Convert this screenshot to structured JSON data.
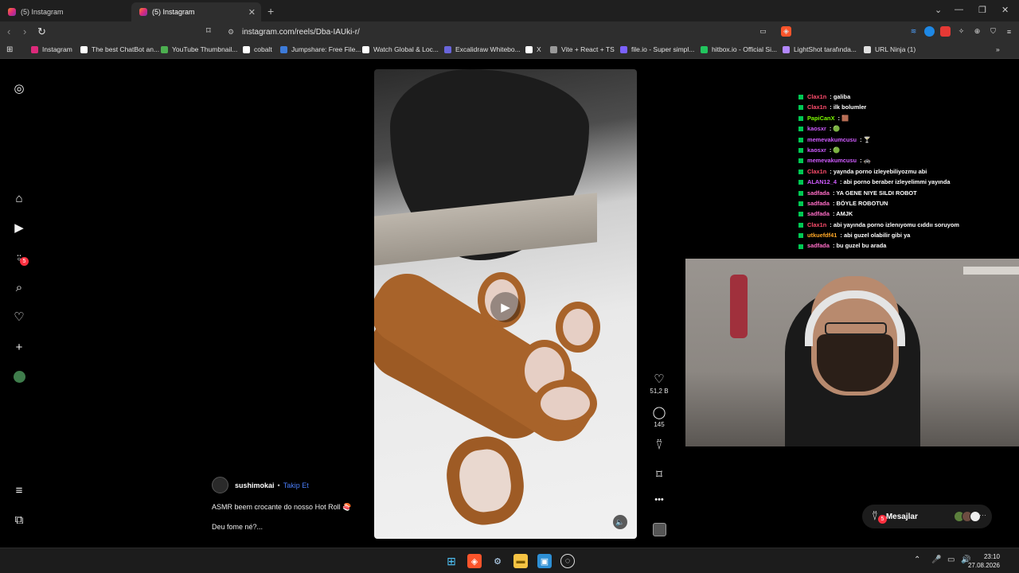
{
  "browser": {
    "tabs": [
      {
        "label": "(5) Instagram"
      },
      {
        "label": "(5) Instagram"
      }
    ],
    "url": "instagram.com/reels/Dba-IAUki-r/",
    "bookmarks": [
      {
        "label": "Instagram",
        "color": "#dd2a7b"
      },
      {
        "label": "The best ChatBot an...",
        "color": "#ffffff"
      },
      {
        "label": "YouTube Thumbnail...",
        "color": "#4caf50"
      },
      {
        "label": "cobalt",
        "color": "#ffffff"
      },
      {
        "label": "Jumpshare: Free File...",
        "color": "#3d7bd9"
      },
      {
        "label": "Watch Global & Loc...",
        "color": "#ffffff"
      },
      {
        "label": "Excalidraw Whitebo...",
        "color": "#6965db"
      },
      {
        "label": "X",
        "color": "#ffffff"
      },
      {
        "label": "Vite + React + TS",
        "color": "#9a9a9a"
      },
      {
        "label": "file.io - Super simpl...",
        "color": "#7b61ff"
      },
      {
        "label": "hitbox.io - Official Si...",
        "color": "#22c55e"
      },
      {
        "label": "LightShot tarafında...",
        "color": "#b388ff"
      },
      {
        "label": "URL Ninja (1)",
        "color": "#e0e0e0"
      }
    ]
  },
  "sidebar": {
    "notification_count": "5"
  },
  "reel": {
    "username": "sushimokai",
    "follow_label": "Takip Et",
    "caption_line1": "ASMR beem crocante do nosso Hot Roll 🍣",
    "caption_line2": "Deu fome né?...",
    "likes": "51,2 B",
    "comments": "145"
  },
  "chat": [
    {
      "user": "Clax1n",
      "color": "#ff4d6d",
      "text": "galiba"
    },
    {
      "user": "Clax1n",
      "color": "#ff4d6d",
      "text": "ilk bolumler"
    },
    {
      "user": "PapiCanX",
      "color": "#7cfc00",
      "text": "🟫"
    },
    {
      "user": "kaosxr",
      "color": "#d05cff",
      "text": "🟢"
    },
    {
      "user": "memevakumcusu",
      "color": "#d05cff",
      "text": "🍸"
    },
    {
      "user": "kaosxr",
      "color": "#d05cff",
      "text": "🟢"
    },
    {
      "user": "memevakumcusu",
      "color": "#d05cff",
      "text": "🚓"
    },
    {
      "user": "Clax1n",
      "color": "#ff4d6d",
      "text": "yaynda porno izleyebiliyozmu abi"
    },
    {
      "user": "ALAN12_4",
      "color": "#d05cff",
      "text": "abi porno beraber izleyelimmi yayında"
    },
    {
      "user": "sadfada",
      "color": "#ff6ec7",
      "text": "YA GENE NIYE SILDI ROBOT"
    },
    {
      "user": "sadfada",
      "color": "#ff6ec7",
      "text": "BÖYLE ROBOTUN"
    },
    {
      "user": "sadfada",
      "color": "#ff6ec7",
      "text": "AMJK"
    },
    {
      "user": "Clax1n",
      "color": "#ff4d6d",
      "text": "abi yayında porno izlenıyomu cıddıı soruyom"
    },
    {
      "user": "utkuefdf41",
      "color": "#ffa726",
      "text": "abi guzel olabilir gibi ya"
    },
    {
      "user": "sadfada",
      "color": "#ff6ec7",
      "text": "bu guzel bu arada"
    }
  ],
  "messages_pill": {
    "label": "Mesajlar",
    "count": "5"
  },
  "clock": {
    "time": "23:10",
    "date": "27.08.2026"
  }
}
